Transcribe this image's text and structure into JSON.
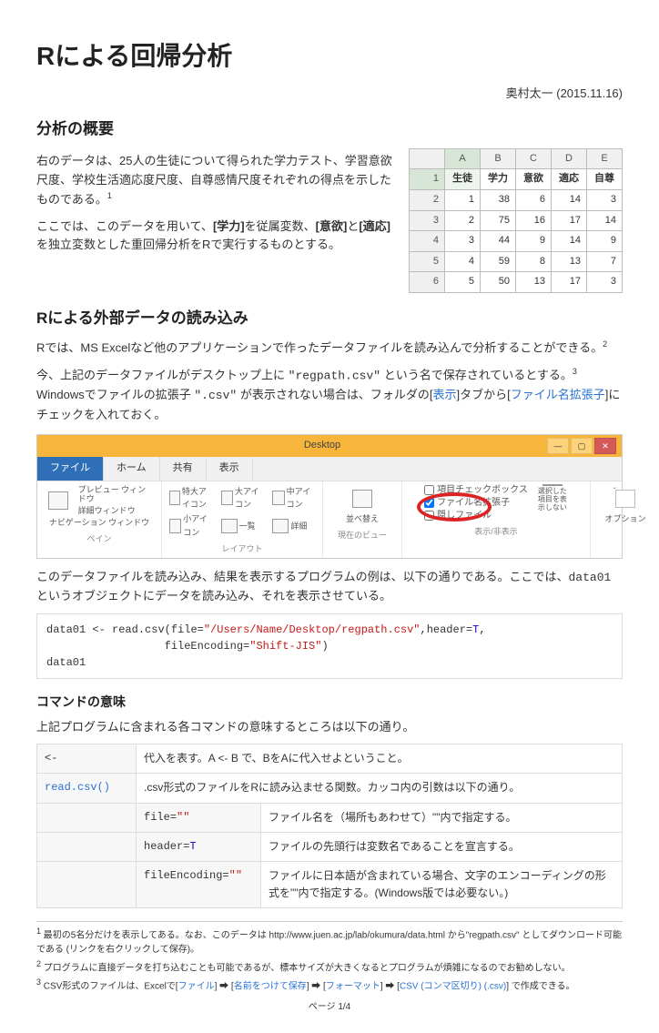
{
  "title": "Rによる回帰分析",
  "author_date": "奥村太一 (2015.11.16)",
  "sec1": {
    "h": "分析の概要",
    "p1a": "右のデータは、25人の生徒について得られた学力テスト、学習意欲尺度、学校生活適応度尺度、自尊感情尺度それぞれの得点を示したものである。",
    "sup1": "1",
    "p2a": "ここでは、このデータを用いて、",
    "b1": "[学力]",
    "p2b": "を従属変数、",
    "b2": "[意欲]",
    "p2c": "と",
    "b3": "[適応]",
    "p2d": "を独立変数とした重回帰分析をRで実行するものとする。"
  },
  "excel": {
    "cols": [
      "",
      "A",
      "B",
      "C",
      "D",
      "E"
    ],
    "headrow": [
      "1",
      "生徒",
      "学力",
      "意欲",
      "適応",
      "自尊"
    ],
    "rows": [
      [
        "2",
        "1",
        "38",
        "6",
        "14",
        "3"
      ],
      [
        "3",
        "2",
        "75",
        "16",
        "17",
        "14"
      ],
      [
        "4",
        "3",
        "44",
        "9",
        "14",
        "9"
      ],
      [
        "5",
        "4",
        "59",
        "8",
        "13",
        "7"
      ],
      [
        "6",
        "5",
        "50",
        "13",
        "17",
        "3"
      ]
    ]
  },
  "sec2": {
    "h": "Rによる外部データの読み込み",
    "p1": "Rでは、MS Excelなど他のアプリケーションで作ったデータファイルを読み込んで分析することができる。",
    "sup2": "2",
    "p2a": "今、上記のデータファイルがデスクトップ上に",
    "fname": "\"regpath.csv\"",
    "p2b": "という名で保存されているとする。",
    "sup3": "3",
    "p2c": " Windowsでファイルの拡張子",
    "ext": "\".csv\"",
    "p2d": "が表示されない場合は、フォルダの[",
    "lnk1": "表示",
    "p2e": "]タブから[",
    "lnk2": "ファイル名拡張子",
    "p2f": "]にチェックを入れておく。"
  },
  "explorer": {
    "title": "Desktop",
    "tabs": {
      "file": "ファイル",
      "home": "ホーム",
      "share": "共有",
      "view": "表示"
    },
    "groups": {
      "pane": "ペイン",
      "layout": "レイアウト",
      "current": "現在のビュー",
      "show": "表示/非表示"
    },
    "left": {
      "nav": "ナビゲーション ウィンドウ",
      "preview": "プレビュー ウィンドウ",
      "detail": "詳細ウィンドウ"
    },
    "layout": {
      "xl": "特大アイコン",
      "l": "大アイコン",
      "m": "中アイコン",
      "s": "小アイコン",
      "list": "一覧",
      "detail": "詳細"
    },
    "cur": {
      "sort": "並べ替え"
    },
    "checks": {
      "itemcheck": "項目チェックボックス",
      "ext": "ファイル名拡張子",
      "hidden": "隠しファイル"
    },
    "hide": "選択した項目を表示しない",
    "options": "オプション"
  },
  "sec2b": {
    "p": "このデータファイルを読み込み、結果を表示するプログラムの例は、以下の通りである。ここでは、",
    "obj": "data01",
    "p2": "というオブジェクトにデータを読み込み、それを表示させている。"
  },
  "code": {
    "l1a": "data01 ",
    "l1b": "<-",
    "l1c": " read.csv(",
    "l1d": "file",
    "l1e": "=",
    "l1f": "\"/Users/Name/Desktop/regpath.csv\"",
    "l1g": ",header=",
    "l1h": "T",
    "l1i": ",",
    "l2a": "                  fileEncoding=",
    "l2b": "\"Shift-JIS\"",
    "l2c": ")",
    "l3": "data01"
  },
  "sec3": {
    "h": "コマンドの意味",
    "p": "上記プログラムに含まれる各コマンドの意味するところは以下の通り。"
  },
  "cmd": {
    "r1": {
      "c1": "<-",
      "c2": "",
      "d": "代入を表す。A <- B で、BをAに代入せよということ。"
    },
    "r2": {
      "c1": "read.csv()",
      "c2": "",
      "d": ".csv形式のファイルをRに読み込ませる関数。カッコ内の引数は以下の通り。"
    },
    "r3": {
      "c1": "",
      "c2": "file=\"\"",
      "d": "ファイル名を（場所もあわせて）\"\"内で指定する。"
    },
    "r4": {
      "c1": "",
      "c2": "header=T",
      "d": "ファイルの先頭行は変数名であることを宣言する。"
    },
    "r5": {
      "c1": "",
      "c2": "fileEncoding=\"\"",
      "d": "ファイルに日本語が含まれている場合、文字のエンコーディングの形式を\"\"内で指定する。(Windows版では必要ない。)"
    }
  },
  "footnotes": {
    "f1": "最初の5名分だけを表示してある。なお、このデータは http://www.juen.ac.jp/lab/okumura/data.html から\"regpath.csv\" としてダウンロード可能である (リンクを右クリックして保存)。",
    "f2": "プログラムに直接データを打ち込むことも可能であるが、標本サイズが大きくなるとプログラムが煩雑になるのでお勧めしない。",
    "f3a": "CSV形式のファイルは、Excelで[",
    "f3l1": "ファイル",
    "f3b": "] ➡ [",
    "f3l2": "名前をつけて保存",
    "f3c": "] ➡ [",
    "f3l3": "フォーマット",
    "f3d": "] ➡ [",
    "f3l4": "CSV (コンマ区切り) (.csv)",
    "f3e": "] で作成できる。"
  },
  "page_no": "ページ 1/4"
}
